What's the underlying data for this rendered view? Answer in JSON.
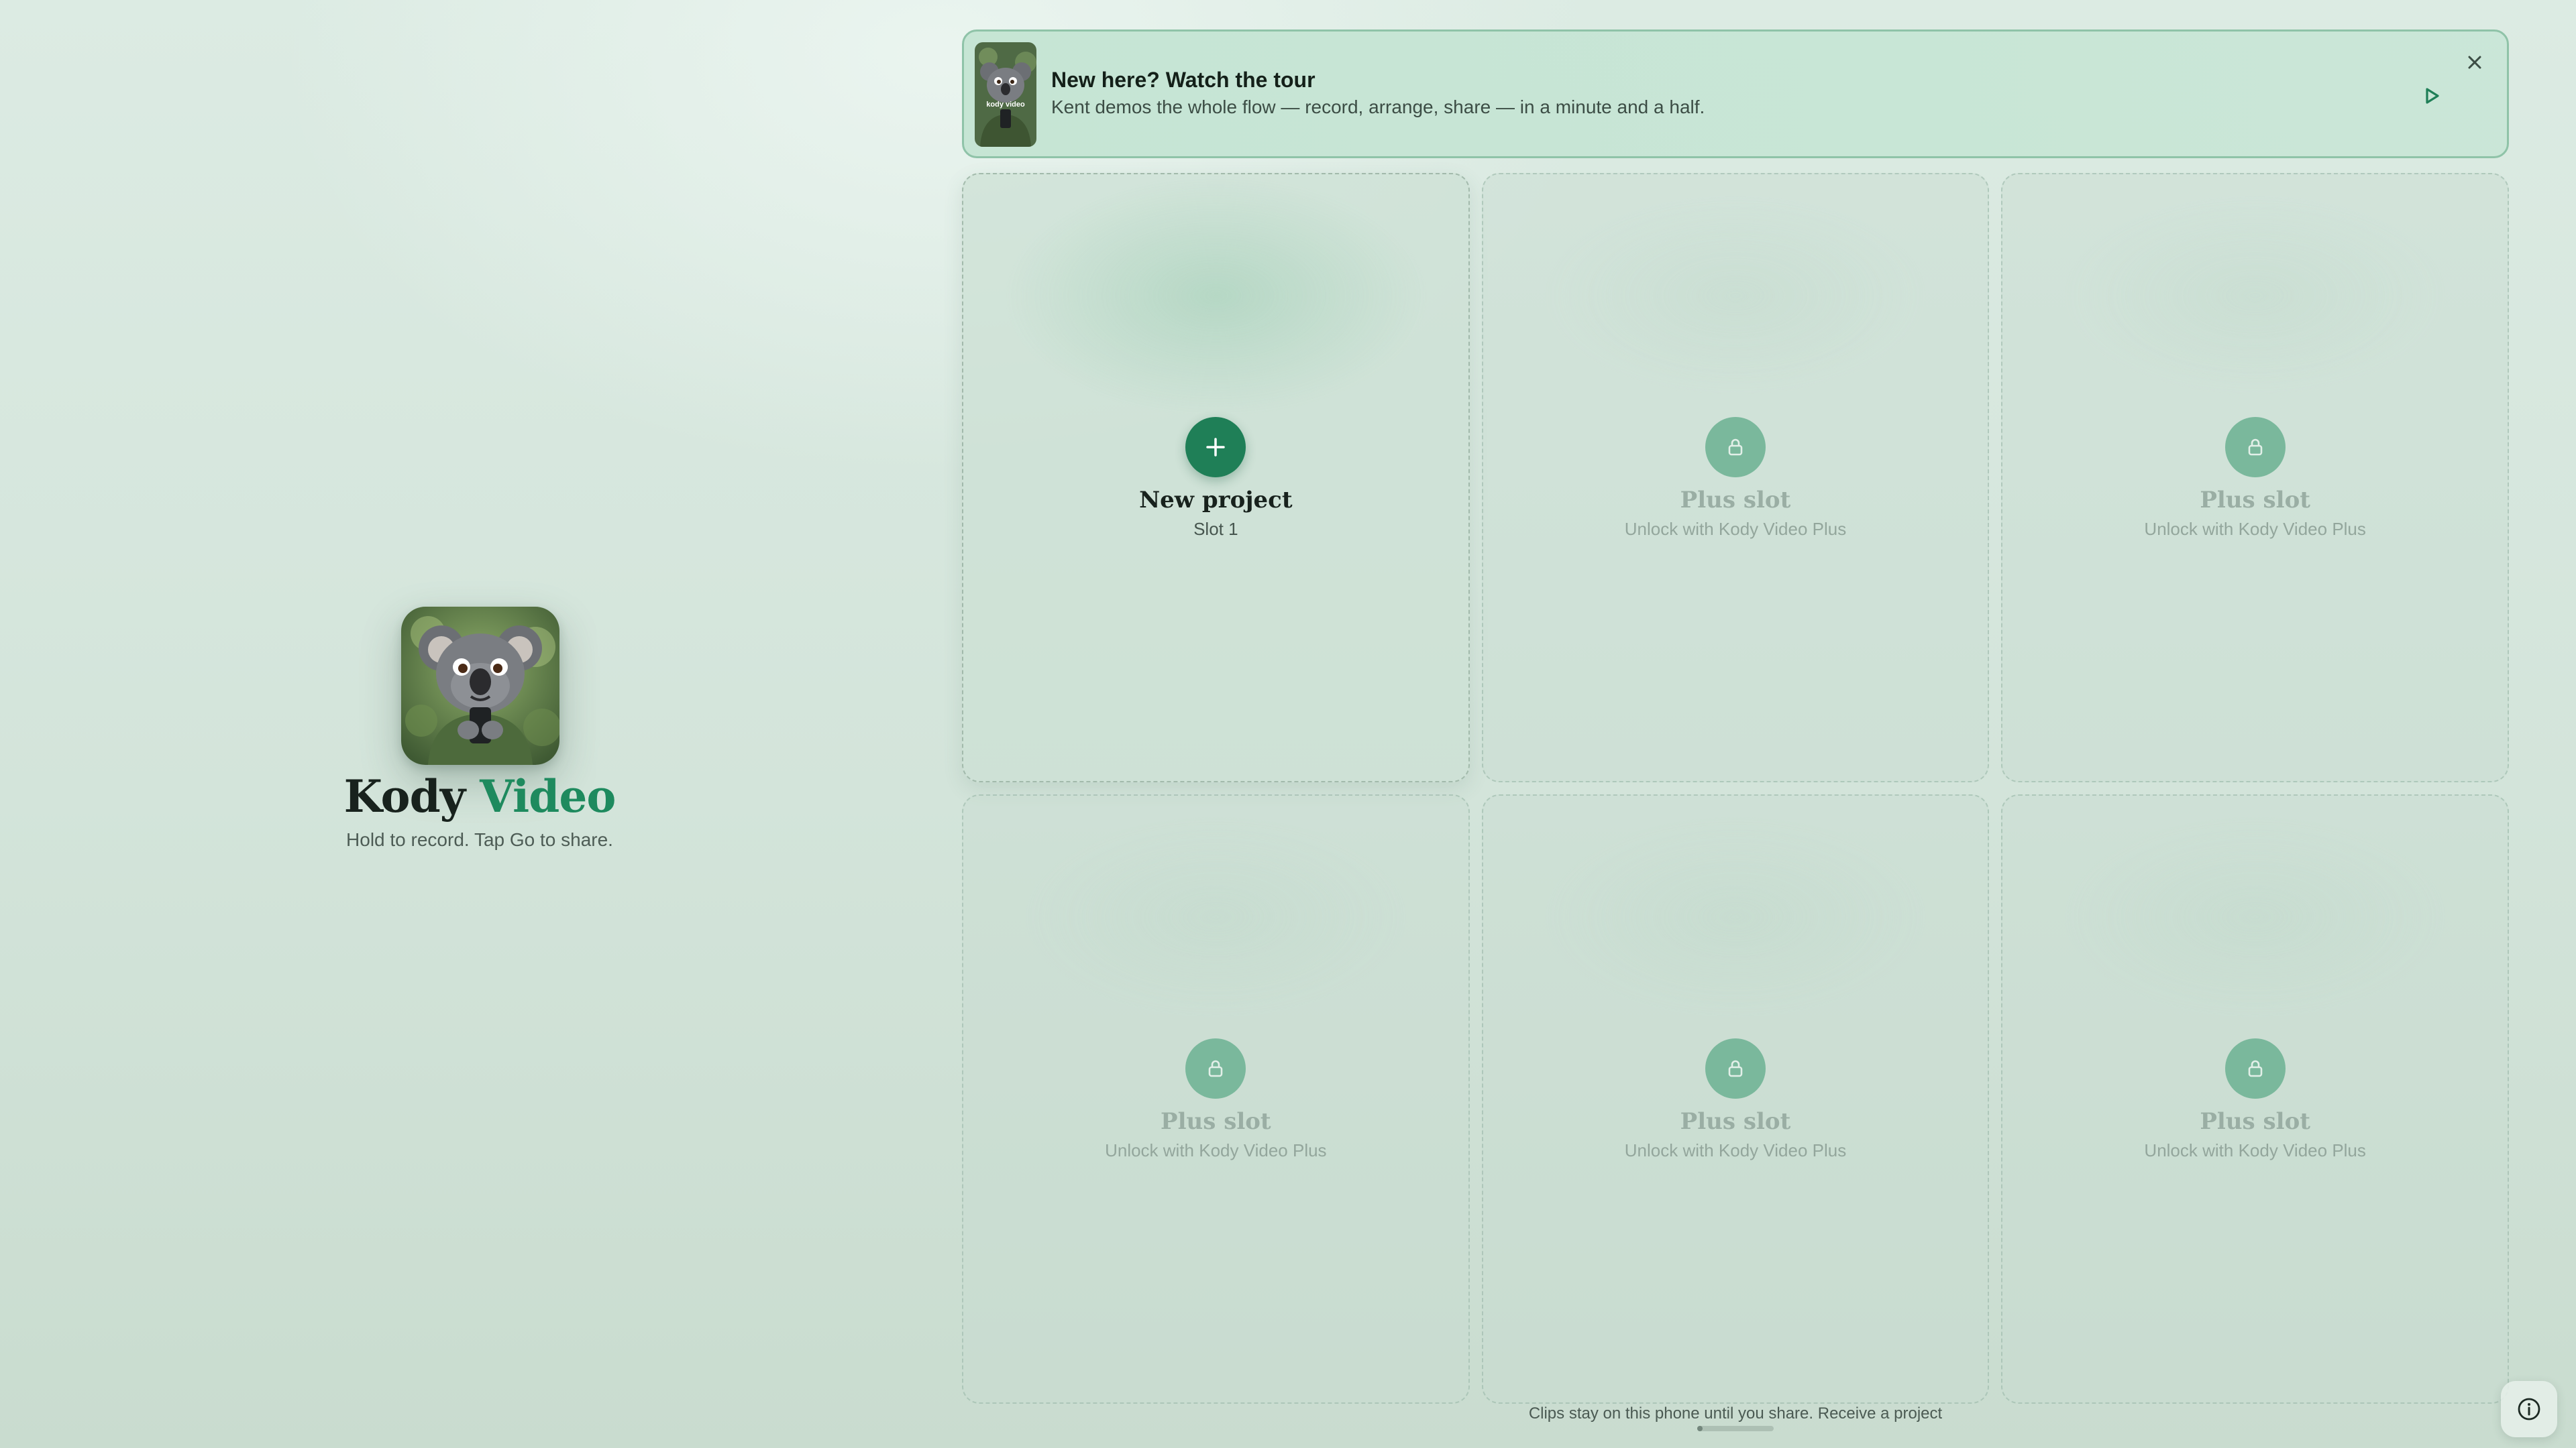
{
  "brand": {
    "name_primary": "Kody",
    "name_accent": "Video",
    "tagline": "Hold to record. Tap Go to share.",
    "icon": "koala-app-icon",
    "accent_color": "#1e8a5e"
  },
  "tour": {
    "title": "New here? Watch the tour",
    "description": "Kent demos the whole flow — record, arrange, share — in a minute and a half.",
    "thumbnail_text": "kody video",
    "close_icon": "close-icon",
    "play_icon": "play-icon",
    "border_color": "#8fc3a8"
  },
  "slots": [
    {
      "title": "New project",
      "subtitle": "Slot 1",
      "icon": "plus-icon",
      "state": "active"
    },
    {
      "title": "Plus slot",
      "subtitle": "Unlock with Kody Video Plus",
      "icon": "lock-icon",
      "state": "locked"
    },
    {
      "title": "Plus slot",
      "subtitle": "Unlock with Kody Video Plus",
      "icon": "lock-icon",
      "state": "locked"
    },
    {
      "title": "Plus slot",
      "subtitle": "Unlock with Kody Video Plus",
      "icon": "lock-icon",
      "state": "locked"
    },
    {
      "title": "Plus slot",
      "subtitle": "Unlock with Kody Video Plus",
      "icon": "lock-icon",
      "state": "locked"
    },
    {
      "title": "Plus slot",
      "subtitle": "Unlock with Kody Video Plus",
      "icon": "lock-icon",
      "state": "locked"
    }
  ],
  "footer": {
    "text": "Clips stay on this phone until you share.",
    "link": "Receive a project"
  },
  "info_button": {
    "icon": "info-icon"
  },
  "colors": {
    "primary_button": "#1f7f57",
    "locked_button": "#7ab89c"
  }
}
